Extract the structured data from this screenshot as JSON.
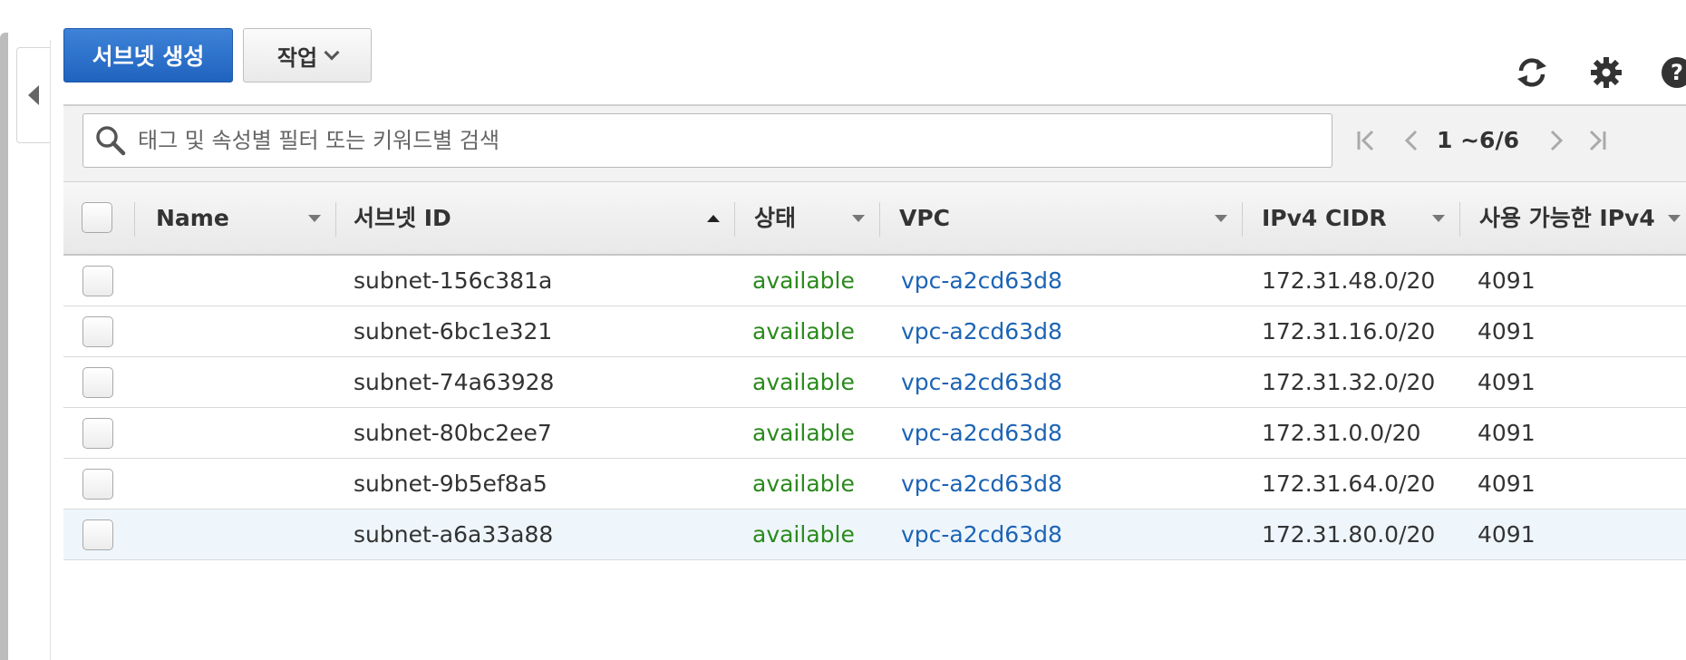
{
  "toolbar": {
    "create_subnet_label": "서브넷 생성",
    "actions_label": "작업",
    "icons": [
      "refresh-icon",
      "gear-icon",
      "help-icon"
    ]
  },
  "filter": {
    "placeholder": "태그 및 속성별 필터 또는 키워드별 검색"
  },
  "pagination": {
    "text": "1 ~6/6"
  },
  "table": {
    "columns": [
      "Name",
      "서브넷 ID",
      "상태",
      "VPC",
      "IPv4 CIDR",
      "사용 가능한 IPv4"
    ],
    "sorted_column": "서브넷 ID",
    "rows": [
      {
        "name": "",
        "subnet_id": "subnet-156c381a",
        "state": "available",
        "vpc": "vpc-a2cd63d8",
        "cidr": "172.31.48.0/20",
        "available_ipv4": "4091"
      },
      {
        "name": "",
        "subnet_id": "subnet-6bc1e321",
        "state": "available",
        "vpc": "vpc-a2cd63d8",
        "cidr": "172.31.16.0/20",
        "available_ipv4": "4091"
      },
      {
        "name": "",
        "subnet_id": "subnet-74a63928",
        "state": "available",
        "vpc": "vpc-a2cd63d8",
        "cidr": "172.31.32.0/20",
        "available_ipv4": "4091"
      },
      {
        "name": "",
        "subnet_id": "subnet-80bc2ee7",
        "state": "available",
        "vpc": "vpc-a2cd63d8",
        "cidr": "172.31.0.0/20",
        "available_ipv4": "4091"
      },
      {
        "name": "",
        "subnet_id": "subnet-9b5ef8a5",
        "state": "available",
        "vpc": "vpc-a2cd63d8",
        "cidr": "172.31.64.0/20",
        "available_ipv4": "4091"
      },
      {
        "name": "",
        "subnet_id": "subnet-a6a33a88",
        "state": "available",
        "vpc": "vpc-a2cd63d8",
        "cidr": "172.31.80.0/20",
        "available_ipv4": "4091"
      }
    ]
  },
  "colors": {
    "primary": "#2a6fcc",
    "available": "#2a8a1c",
    "link": "#1d64b5"
  }
}
